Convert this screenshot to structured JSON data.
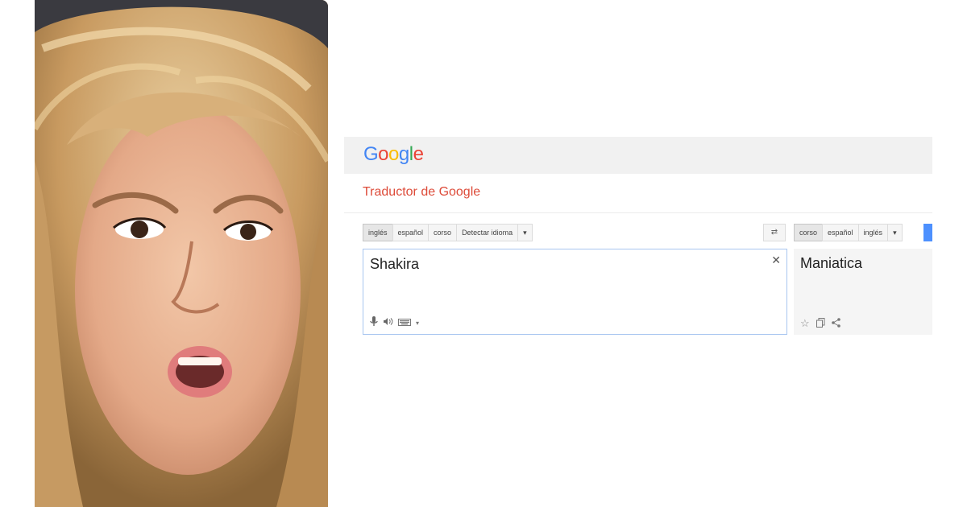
{
  "photo": {
    "subject": "woman-with-blonde-curly-hair-surprised-expression"
  },
  "header": {
    "logo_letters": [
      "G",
      "o",
      "o",
      "g",
      "l",
      "e"
    ],
    "logo_colors": [
      "#4285f4",
      "#ea4335",
      "#fbbc05",
      "#4285f4",
      "#34a853",
      "#ea4335"
    ],
    "subtitle": "Traductor de Google"
  },
  "source_langs": {
    "items": [
      "inglés",
      "español",
      "corso",
      "Detectar idioma"
    ],
    "active_index": 0
  },
  "target_langs": {
    "items": [
      "corso",
      "español",
      "inglés"
    ],
    "active_index": 0
  },
  "source": {
    "text": "Shakira"
  },
  "target": {
    "text": "Maniatica"
  },
  "colors": {
    "subtitle": "#dd4b39",
    "accent_blue": "#4d90fe",
    "bar_bg": "#f1f1f1"
  }
}
